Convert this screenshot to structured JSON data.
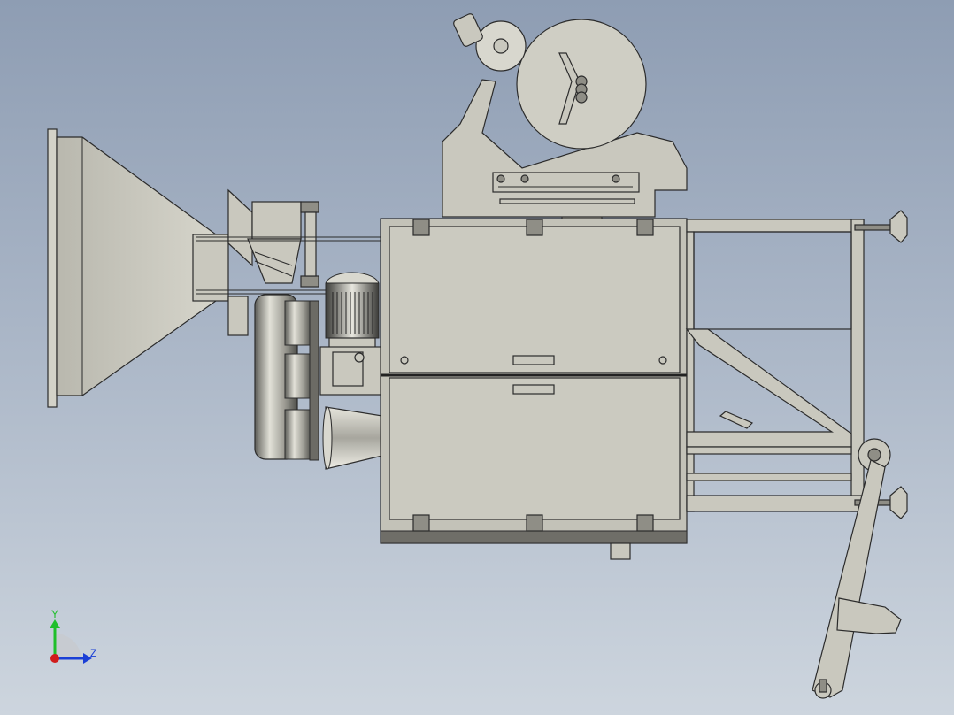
{
  "viewport": {
    "background_top": "#8e9db3",
    "background_bottom": "#cdd5de",
    "part_fill": "#c9c8be",
    "edge_color": "#2b2b2b"
  },
  "triad": {
    "y_label": "Y",
    "z_label": "Z",
    "y_color": "#1fbf2a",
    "z_color": "#1a3fd6",
    "x_color": "#d01c1c"
  }
}
